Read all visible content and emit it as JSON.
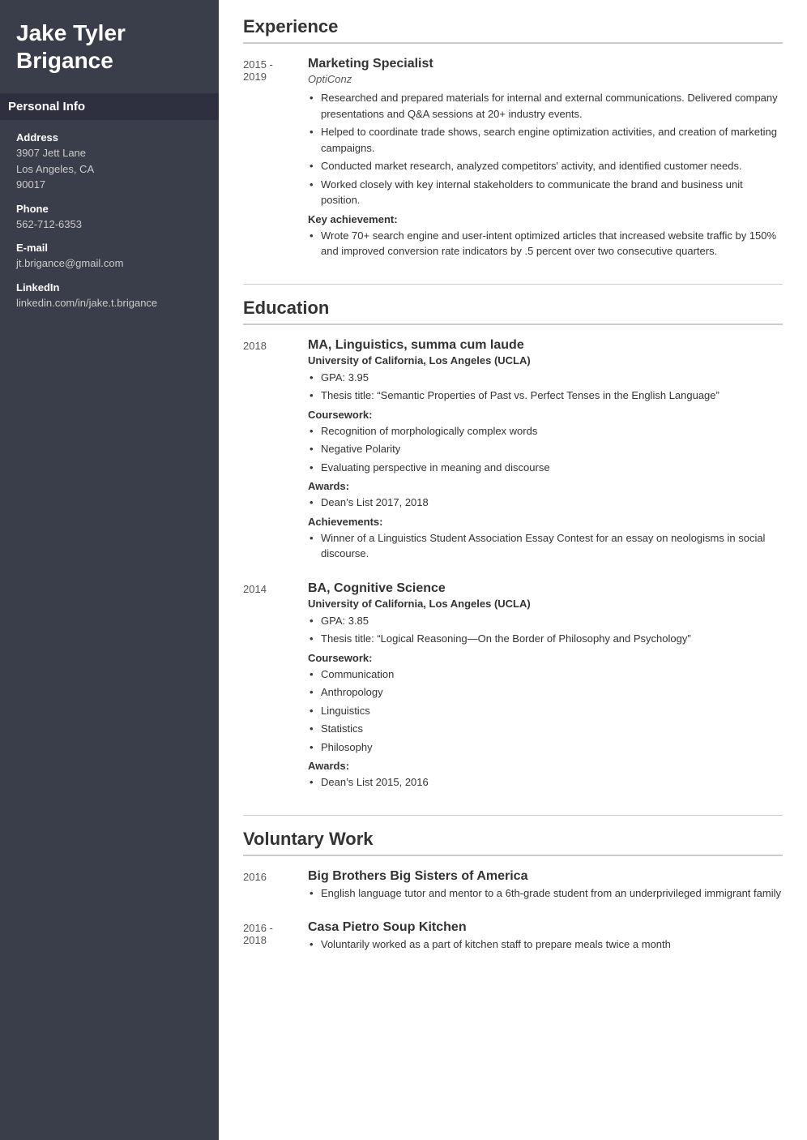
{
  "sidebar": {
    "name": "Jake Tyler Brigance",
    "personal_info_title": "Personal Info",
    "fields": [
      {
        "label": "Address",
        "value": "3907 Jett Lane\nLos Angeles, CA\n90017"
      },
      {
        "label": "Phone",
        "value": "562-712-6353"
      },
      {
        "label": "E-mail",
        "value": "jt.brigance@gmail.com"
      },
      {
        "label": "LinkedIn",
        "value": "linkedin.com/in/jake.t.brigance"
      }
    ]
  },
  "main": {
    "sections": {
      "experience": {
        "title": "Experience",
        "entries": [
          {
            "years": "2015 - 2019",
            "title": "Marketing Specialist",
            "org": "OptiConz",
            "bullets": [
              "Researched and prepared materials for internal and external communications. Delivered company presentations and Q&A sessions at 20+ industry events.",
              "Helped to coordinate trade shows, search engine optimization activities, and creation of marketing campaigns.",
              "Conducted market research, analyzed competitors' activity, and identified customer needs.",
              "Worked closely with key internal stakeholders to communicate the brand and business unit position."
            ],
            "key_achievement_label": "Key achievement:",
            "key_achievement_bullets": [
              "Wrote 70+ search engine and user-intent optimized articles that increased website traffic by 150% and improved conversion rate indicators by .5 percent over two consecutive quarters."
            ]
          }
        ]
      },
      "education": {
        "title": "Education",
        "entries": [
          {
            "year": "2018",
            "title": "MA, Linguistics, summa cum laude",
            "org_bold": "University of California, Los Angeles (UCLA)",
            "gpa": "GPA: 3.95",
            "thesis": "Thesis title: “Semantic Properties of Past vs. Perfect Tenses in the English Language”",
            "coursework_label": "Coursework:",
            "coursework": [
              "Recognition of morphologically complex words",
              "Negative Polarity",
              "Evaluating perspective in meaning and discourse"
            ],
            "awards_label": "Awards:",
            "awards": [
              "Dean’s List 2017, 2018"
            ],
            "achievements_label": "Achievements:",
            "achievements": [
              "Winner of a Linguistics Student Association Essay Contest for an essay on neologisms in social discourse."
            ]
          },
          {
            "year": "2014",
            "title": "BA, Cognitive Science",
            "org_bold": "University of California, Los Angeles (UCLA)",
            "gpa": "GPA: 3.85",
            "thesis": "Thesis title: “Logical Reasoning—On the Border of Philosophy and Psychology”",
            "coursework_label": "Coursework:",
            "coursework": [
              "Communication",
              "Anthropology",
              "Linguistics",
              "Statistics",
              "Philosophy"
            ],
            "awards_label": "Awards:",
            "awards": [
              "Dean’s List 2015, 2016"
            ]
          }
        ]
      },
      "voluntary": {
        "title": "Voluntary Work",
        "entries": [
          {
            "year": "2016",
            "title": "Big Brothers Big Sisters of America",
            "bullets": [
              "English language tutor and mentor to a 6th-grade student from an underprivileged immigrant family"
            ]
          },
          {
            "year": "2016 - 2018",
            "title": "Casa Pietro Soup Kitchen",
            "bullets": [
              "Voluntarily worked as a part of kitchen staff to prepare meals twice a month"
            ]
          }
        ]
      }
    }
  }
}
